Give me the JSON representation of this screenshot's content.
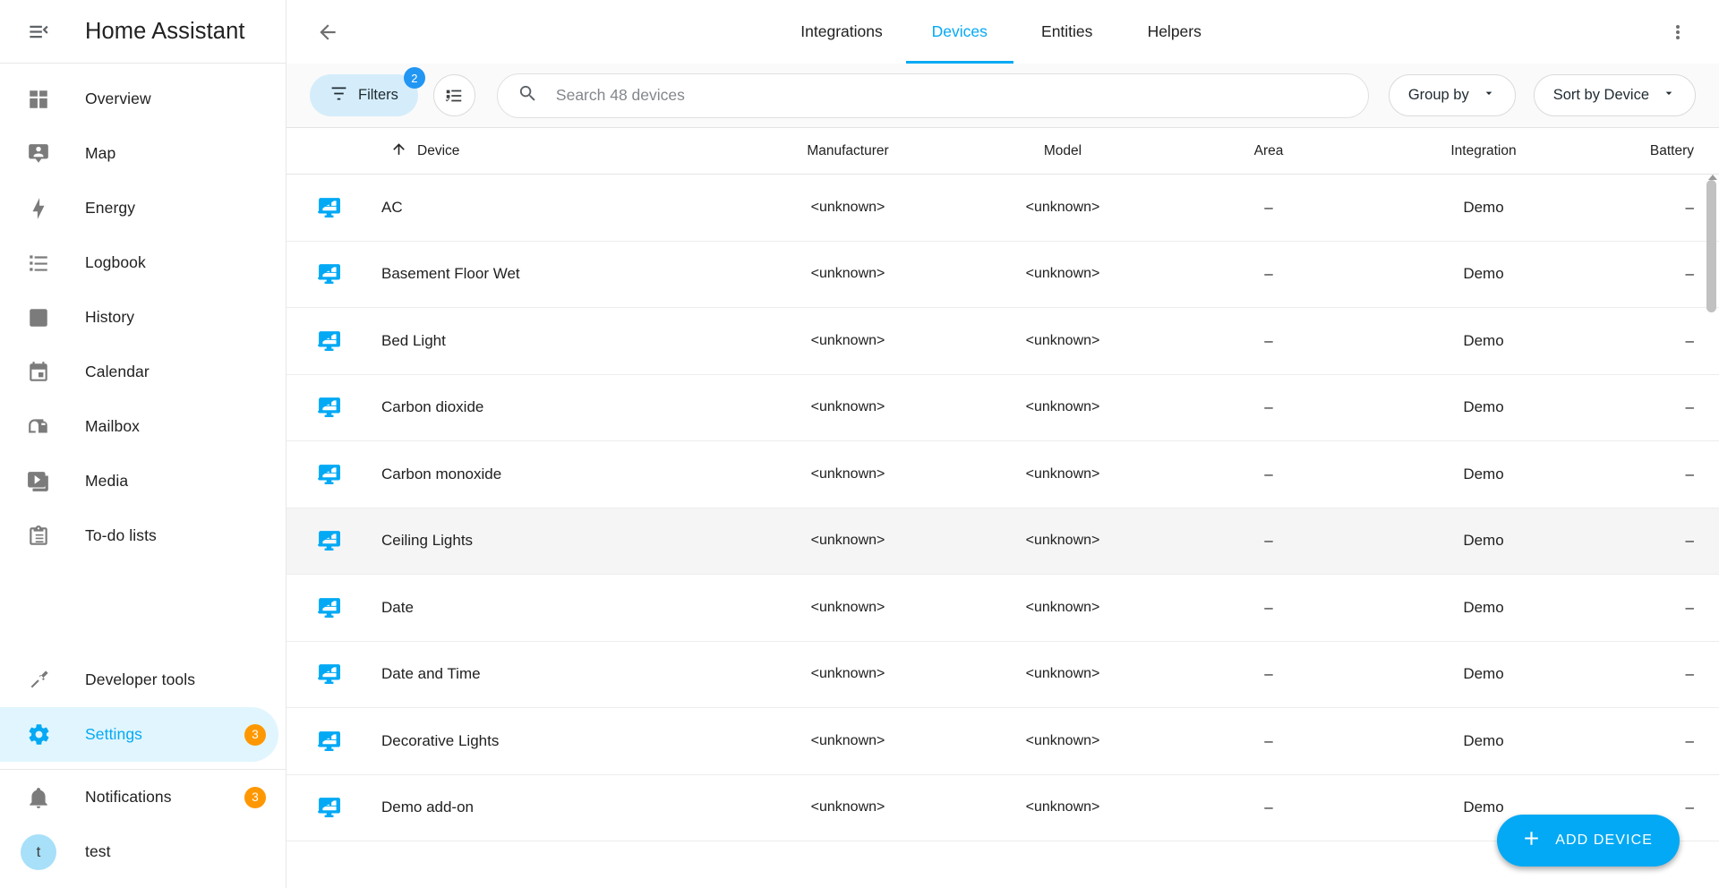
{
  "sidebar": {
    "title": "Home Assistant",
    "menu_icon": "menu-collapse-icon",
    "items": [
      {
        "label": "Overview",
        "icon": "view-dashboard-icon"
      },
      {
        "label": "Map",
        "icon": "map-marker-account-icon"
      },
      {
        "label": "Energy",
        "icon": "lightning-bolt-icon"
      },
      {
        "label": "Logbook",
        "icon": "format-list-bulleted-icon"
      },
      {
        "label": "History",
        "icon": "chart-box-icon"
      },
      {
        "label": "Calendar",
        "icon": "calendar-icon"
      },
      {
        "label": "Mailbox",
        "icon": "mailbox-icon"
      },
      {
        "label": "Media",
        "icon": "play-box-multiple-icon"
      },
      {
        "label": "To-do lists",
        "icon": "clipboard-list-icon"
      }
    ],
    "bottom_items": [
      {
        "label": "Developer tools",
        "icon": "hammer-icon",
        "badge": "",
        "active": false
      },
      {
        "label": "Settings",
        "icon": "cog-icon",
        "badge": "3",
        "active": true
      }
    ],
    "notifications": {
      "label": "Notifications",
      "icon": "bell-icon",
      "badge": "3"
    },
    "user": {
      "label": "test",
      "avatar_initial": "t"
    }
  },
  "topbar": {
    "back_icon": "arrow-left-icon",
    "overflow_icon": "dots-vertical-icon",
    "tabs": [
      {
        "label": "Integrations",
        "active": false
      },
      {
        "label": "Devices",
        "active": true
      },
      {
        "label": "Entities",
        "active": false
      },
      {
        "label": "Helpers",
        "active": false
      }
    ]
  },
  "toolbar": {
    "filters_label": "Filters",
    "filters_icon": "filter-variant-icon",
    "filters_badge": "2",
    "columns_icon": "table-column-settings-icon",
    "search": {
      "icon": "search-icon",
      "placeholder": "Search 48 devices",
      "value": ""
    },
    "group_by_label": "Group by",
    "sort_by_label": "Sort by Device",
    "chevron_icon": "chevron-down-icon"
  },
  "table": {
    "sort_icon": "arrow-up-icon",
    "columns": [
      "Device",
      "Manufacturer",
      "Model",
      "Area",
      "Integration",
      "Battery"
    ],
    "row_icon": "device-monitor-dashboard-icon",
    "rows": [
      {
        "device": "AC",
        "manufacturer": "<unknown>",
        "model": "<unknown>",
        "area": "–",
        "integration": "Demo",
        "battery": "–",
        "hover": false
      },
      {
        "device": "Basement Floor Wet",
        "manufacturer": "<unknown>",
        "model": "<unknown>",
        "area": "–",
        "integration": "Demo",
        "battery": "–",
        "hover": false
      },
      {
        "device": "Bed Light",
        "manufacturer": "<unknown>",
        "model": "<unknown>",
        "area": "–",
        "integration": "Demo",
        "battery": "–",
        "hover": false
      },
      {
        "device": "Carbon dioxide",
        "manufacturer": "<unknown>",
        "model": "<unknown>",
        "area": "–",
        "integration": "Demo",
        "battery": "–",
        "hover": false
      },
      {
        "device": "Carbon monoxide",
        "manufacturer": "<unknown>",
        "model": "<unknown>",
        "area": "–",
        "integration": "Demo",
        "battery": "–",
        "hover": false
      },
      {
        "device": "Ceiling Lights",
        "manufacturer": "<unknown>",
        "model": "<unknown>",
        "area": "–",
        "integration": "Demo",
        "battery": "–",
        "hover": true
      },
      {
        "device": "Date",
        "manufacturer": "<unknown>",
        "model": "<unknown>",
        "area": "–",
        "integration": "Demo",
        "battery": "–",
        "hover": false
      },
      {
        "device": "Date and Time",
        "manufacturer": "<unknown>",
        "model": "<unknown>",
        "area": "–",
        "integration": "Demo",
        "battery": "–",
        "hover": false
      },
      {
        "device": "Decorative Lights",
        "manufacturer": "<unknown>",
        "model": "<unknown>",
        "area": "–",
        "integration": "Demo",
        "battery": "–",
        "hover": false
      },
      {
        "device": "Demo add-on",
        "manufacturer": "<unknown>",
        "model": "<unknown>",
        "area": "–",
        "integration": "Demo",
        "battery": "–",
        "hover": false
      }
    ]
  },
  "fab": {
    "label": "ADD DEVICE",
    "icon": "plus-icon"
  },
  "colors": {
    "accent": "#03a9f4",
    "badge_orange": "#ff9800",
    "badge_blue": "#2196f3",
    "active_bg": "#e1f5fe"
  }
}
